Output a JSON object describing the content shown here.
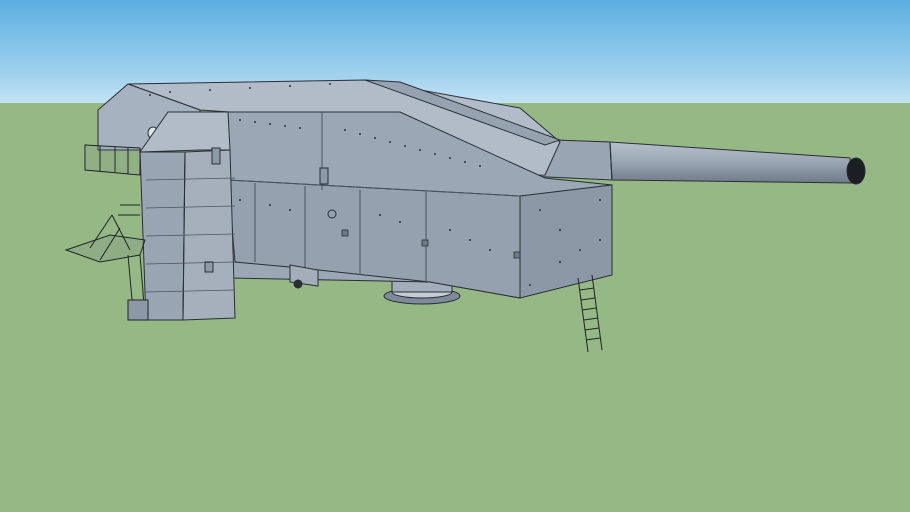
{
  "scene": {
    "colors": {
      "sky_top": "#5aaee0",
      "sky_horizon": "#c2e2f3",
      "ground": "#95b884",
      "steel_light": "#a7b2c0",
      "steel_mid": "#8d98a7",
      "steel_dark": "#6f7a89",
      "outline": "#2a2f36",
      "rivet": "#2c323a"
    },
    "model": {
      "subject": "turret-gun-model",
      "components": [
        "turret-housing",
        "gun-barrel",
        "armored-tower",
        "side-platform",
        "access-ladder",
        "turret-base-ring"
      ]
    }
  }
}
